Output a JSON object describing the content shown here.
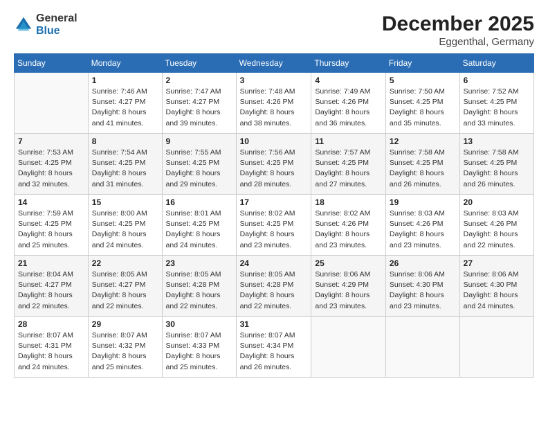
{
  "logo": {
    "line1": "General",
    "line2": "Blue"
  },
  "title": "December 2025",
  "subtitle": "Eggenthal, Germany",
  "days_of_week": [
    "Sunday",
    "Monday",
    "Tuesday",
    "Wednesday",
    "Thursday",
    "Friday",
    "Saturday"
  ],
  "weeks": [
    [
      {
        "day": "",
        "info": ""
      },
      {
        "day": "1",
        "info": "Sunrise: 7:46 AM\nSunset: 4:27 PM\nDaylight: 8 hours\nand 41 minutes."
      },
      {
        "day": "2",
        "info": "Sunrise: 7:47 AM\nSunset: 4:27 PM\nDaylight: 8 hours\nand 39 minutes."
      },
      {
        "day": "3",
        "info": "Sunrise: 7:48 AM\nSunset: 4:26 PM\nDaylight: 8 hours\nand 38 minutes."
      },
      {
        "day": "4",
        "info": "Sunrise: 7:49 AM\nSunset: 4:26 PM\nDaylight: 8 hours\nand 36 minutes."
      },
      {
        "day": "5",
        "info": "Sunrise: 7:50 AM\nSunset: 4:25 PM\nDaylight: 8 hours\nand 35 minutes."
      },
      {
        "day": "6",
        "info": "Sunrise: 7:52 AM\nSunset: 4:25 PM\nDaylight: 8 hours\nand 33 minutes."
      }
    ],
    [
      {
        "day": "7",
        "info": "Sunrise: 7:53 AM\nSunset: 4:25 PM\nDaylight: 8 hours\nand 32 minutes."
      },
      {
        "day": "8",
        "info": "Sunrise: 7:54 AM\nSunset: 4:25 PM\nDaylight: 8 hours\nand 31 minutes."
      },
      {
        "day": "9",
        "info": "Sunrise: 7:55 AM\nSunset: 4:25 PM\nDaylight: 8 hours\nand 29 minutes."
      },
      {
        "day": "10",
        "info": "Sunrise: 7:56 AM\nSunset: 4:25 PM\nDaylight: 8 hours\nand 28 minutes."
      },
      {
        "day": "11",
        "info": "Sunrise: 7:57 AM\nSunset: 4:25 PM\nDaylight: 8 hours\nand 27 minutes."
      },
      {
        "day": "12",
        "info": "Sunrise: 7:58 AM\nSunset: 4:25 PM\nDaylight: 8 hours\nand 26 minutes."
      },
      {
        "day": "13",
        "info": "Sunrise: 7:58 AM\nSunset: 4:25 PM\nDaylight: 8 hours\nand 26 minutes."
      }
    ],
    [
      {
        "day": "14",
        "info": "Sunrise: 7:59 AM\nSunset: 4:25 PM\nDaylight: 8 hours\nand 25 minutes."
      },
      {
        "day": "15",
        "info": "Sunrise: 8:00 AM\nSunset: 4:25 PM\nDaylight: 8 hours\nand 24 minutes."
      },
      {
        "day": "16",
        "info": "Sunrise: 8:01 AM\nSunset: 4:25 PM\nDaylight: 8 hours\nand 24 minutes."
      },
      {
        "day": "17",
        "info": "Sunrise: 8:02 AM\nSunset: 4:25 PM\nDaylight: 8 hours\nand 23 minutes."
      },
      {
        "day": "18",
        "info": "Sunrise: 8:02 AM\nSunset: 4:26 PM\nDaylight: 8 hours\nand 23 minutes."
      },
      {
        "day": "19",
        "info": "Sunrise: 8:03 AM\nSunset: 4:26 PM\nDaylight: 8 hours\nand 23 minutes."
      },
      {
        "day": "20",
        "info": "Sunrise: 8:03 AM\nSunset: 4:26 PM\nDaylight: 8 hours\nand 22 minutes."
      }
    ],
    [
      {
        "day": "21",
        "info": "Sunrise: 8:04 AM\nSunset: 4:27 PM\nDaylight: 8 hours\nand 22 minutes."
      },
      {
        "day": "22",
        "info": "Sunrise: 8:05 AM\nSunset: 4:27 PM\nDaylight: 8 hours\nand 22 minutes."
      },
      {
        "day": "23",
        "info": "Sunrise: 8:05 AM\nSunset: 4:28 PM\nDaylight: 8 hours\nand 22 minutes."
      },
      {
        "day": "24",
        "info": "Sunrise: 8:05 AM\nSunset: 4:28 PM\nDaylight: 8 hours\nand 22 minutes."
      },
      {
        "day": "25",
        "info": "Sunrise: 8:06 AM\nSunset: 4:29 PM\nDaylight: 8 hours\nand 23 minutes."
      },
      {
        "day": "26",
        "info": "Sunrise: 8:06 AM\nSunset: 4:30 PM\nDaylight: 8 hours\nand 23 minutes."
      },
      {
        "day": "27",
        "info": "Sunrise: 8:06 AM\nSunset: 4:30 PM\nDaylight: 8 hours\nand 24 minutes."
      }
    ],
    [
      {
        "day": "28",
        "info": "Sunrise: 8:07 AM\nSunset: 4:31 PM\nDaylight: 8 hours\nand 24 minutes."
      },
      {
        "day": "29",
        "info": "Sunrise: 8:07 AM\nSunset: 4:32 PM\nDaylight: 8 hours\nand 25 minutes."
      },
      {
        "day": "30",
        "info": "Sunrise: 8:07 AM\nSunset: 4:33 PM\nDaylight: 8 hours\nand 25 minutes."
      },
      {
        "day": "31",
        "info": "Sunrise: 8:07 AM\nSunset: 4:34 PM\nDaylight: 8 hours\nand 26 minutes."
      },
      {
        "day": "",
        "info": ""
      },
      {
        "day": "",
        "info": ""
      },
      {
        "day": "",
        "info": ""
      }
    ]
  ]
}
